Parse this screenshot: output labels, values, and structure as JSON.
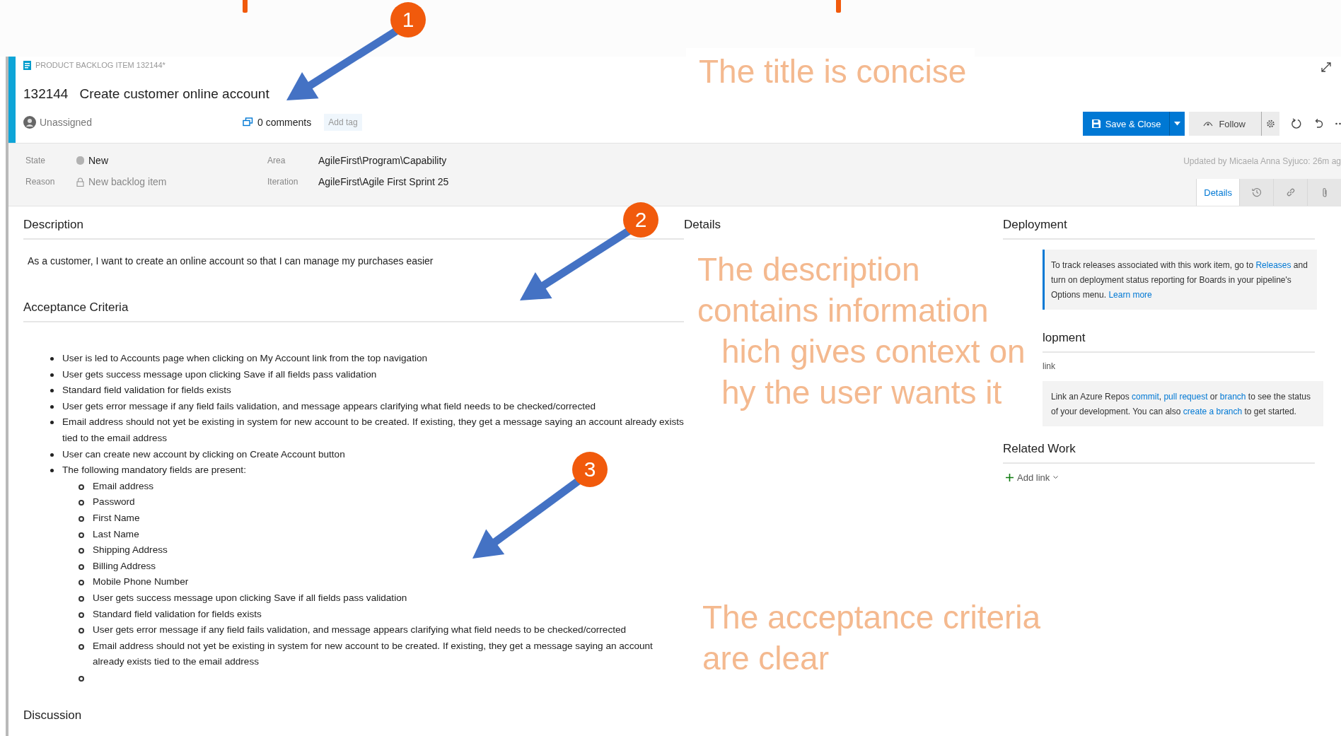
{
  "work_item": {
    "type_label": "PRODUCT BACKLOG ITEM 132144*",
    "id": "132144",
    "title": "Create customer online account",
    "assignee": "Unassigned",
    "comments": "0 comments",
    "add_tag": "Add tag"
  },
  "toolbar": {
    "save": "Save & Close",
    "follow": "Follow"
  },
  "fields": [
    {
      "label": "State",
      "value": "New",
      "kind": "state"
    },
    {
      "label": "Reason",
      "value": "New backlog item",
      "kind": "locked"
    },
    {
      "label": "Area",
      "value": "AgileFirst\\Program\\Capability",
      "kind": "plain"
    },
    {
      "label": "Iteration",
      "value": "AgileFirst\\Agile First Sprint 25",
      "kind": "plain"
    }
  ],
  "updated": "Updated by Micaela Anna Syjuco: 26m ag",
  "tabs": [
    {
      "kind": "details",
      "label": "Details",
      "selected": true
    },
    {
      "kind": "history",
      "selected": false
    },
    {
      "kind": "links",
      "selected": false
    },
    {
      "kind": "attachments",
      "selected": false
    }
  ],
  "description": {
    "heading": "Description",
    "text": "As a customer, I want to create an online account so that I can manage my purchases easier"
  },
  "acceptance": {
    "heading": "Acceptance Criteria",
    "items": [
      {
        "text": "User is led to Accounts page when clicking on My Account link from the top navigation"
      },
      {
        "text": "User gets success message upon clicking Save if all fields pass validation"
      },
      {
        "text": "Standard field validation for fields exists"
      },
      {
        "text": "User gets error message if any field fails validation, and message appears clarifying what field needs to be checked/corrected"
      },
      {
        "text": "Email address should not yet be existing in system for new account to be created. If existing, they get a message saying an account already exists tied to the email address"
      },
      {
        "text": "User can create new account by clicking on Create Account button"
      },
      {
        "text": "The following mandatory fields are present:",
        "children": [
          {
            "text": "Email address"
          },
          {
            "text": "Password"
          },
          {
            "text": "First Name"
          },
          {
            "text": "Last Name"
          },
          {
            "text": "Shipping Address"
          },
          {
            "text": "Billing Address"
          },
          {
            "text": "Mobile Phone Number"
          },
          {
            "text": "User gets success message upon clicking Save if all fields pass validation"
          },
          {
            "text": "Standard field validation for fields exists"
          },
          {
            "text": "User gets error message if any field fails validation, and message appears clarifying what field needs to be checked/corrected"
          },
          {
            "text": "Email address should not yet be existing in system for new account to be created. If existing, they get a message saying an account already exists tied to the email address"
          },
          {
            "kind": "empty"
          }
        ]
      }
    ]
  },
  "discussion": {
    "heading": "Discussion"
  },
  "details": {
    "heading": "Details"
  },
  "deployment": {
    "heading": "Deployment",
    "segments": [
      {
        "text": "To track releases associated with this work item, go to ",
        "link": false
      },
      {
        "text": "Releases",
        "link": true
      },
      {
        "text": " and turn on deployment status reporting for Boards in your pipeline's Options menu. ",
        "link": false
      },
      {
        "text": "Learn more",
        "link": true
      }
    ]
  },
  "development": {
    "heading": "lopment",
    "add_link": "link",
    "segments": [
      {
        "text": "Link an Azure Repos ",
        "link": false
      },
      {
        "text": "commit",
        "link": true
      },
      {
        "text": ", ",
        "link": false
      },
      {
        "text": "pull request",
        "link": true
      },
      {
        "text": " or ",
        "link": false
      },
      {
        "text": "branch",
        "link": true
      },
      {
        "text": " to see the status of your development. You can also ",
        "link": false
      },
      {
        "text": "create a branch",
        "link": true
      },
      {
        "text": " to get started.",
        "link": false
      }
    ]
  },
  "related_work": {
    "heading": "Related Work",
    "add_link": "Add link"
  },
  "callouts": [
    {
      "lines": [
        "The title is concise"
      ]
    },
    {
      "lines": [
        "The description",
        "contains information",
        "hich gives context on",
        "hy the user wants it"
      ]
    },
    {
      "lines": [
        "The acceptance criteria",
        "are clear"
      ]
    }
  ],
  "badges": [
    "1",
    "2",
    "3"
  ]
}
